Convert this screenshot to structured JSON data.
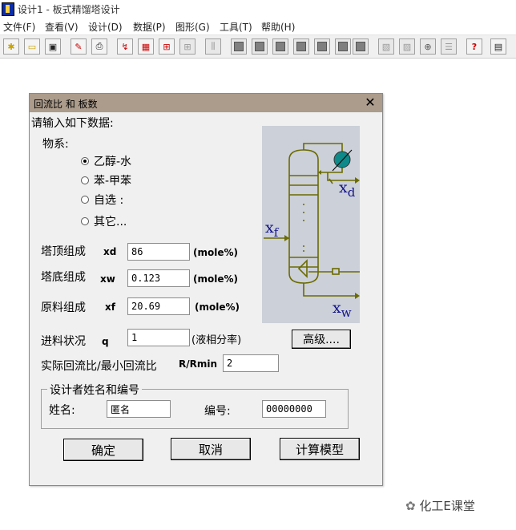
{
  "app": {
    "title": "设计1 - 板式精馏塔设计"
  },
  "menu": [
    "文件(F)",
    "查看(V)",
    "设计(D)",
    "数据(P)",
    "图形(G)",
    "工具(T)",
    "帮助(H)"
  ],
  "dialog": {
    "title": "回流比 和 板数",
    "prompt": "请输入如下数据:",
    "system_label": "物系:",
    "radios": [
      "乙醇-水",
      "苯-甲苯",
      "自选 :",
      "其它..."
    ],
    "selected_radio": 0,
    "rows": [
      {
        "label": "塔顶组成",
        "sym": "xd",
        "value": "86",
        "unit": "(mole%)"
      },
      {
        "label": "塔底组成",
        "sym": "xw",
        "value": "0.123",
        "unit": "(mole%)"
      },
      {
        "label": "原料组成",
        "sym": "xf",
        "value": "20.69",
        "unit": "(mole%)"
      }
    ],
    "feed": {
      "label": "进料状况",
      "sym": "q",
      "value": "1",
      "unit": "(液相分率)"
    },
    "advanced_label": "高级....",
    "ratio": {
      "label": "实际回流比/最小回流比",
      "sym": "R/Rmin",
      "value": "2"
    },
    "designer": {
      "group_label": "设计者姓名和编号",
      "name_label": "姓名:",
      "name_value": "匿名",
      "id_label": "编号:",
      "id_value": "00000000"
    },
    "buttons": {
      "ok": "确定",
      "cancel": "取消",
      "model": "计算模型"
    },
    "diagram": {
      "xd": "x",
      "xd_sub": "d",
      "xf": "x",
      "xf_sub": "f",
      "xw": "x",
      "xw_sub": "w"
    }
  },
  "watermark": "化工E课堂"
}
